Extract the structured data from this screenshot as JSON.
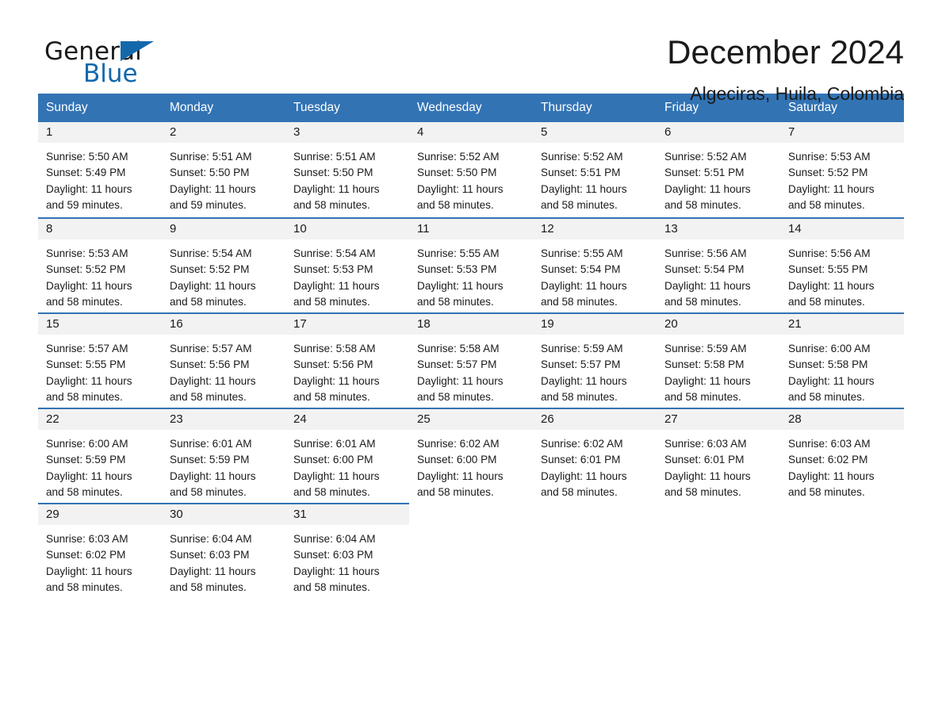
{
  "brand": {
    "word_one": "General",
    "word_two": "Blue",
    "triangle_icon": "triangle-logo-icon",
    "accent_color": "#1368ab"
  },
  "header": {
    "month_title": "December 2024",
    "location": "Algeciras, Huila, Colombia"
  },
  "theme": {
    "header_blue": "#3273b4",
    "daynum_bg": "#f2f2f2",
    "text": "#1a1a1a"
  },
  "calendar": {
    "weekday_headers": [
      "Sunday",
      "Monday",
      "Tuesday",
      "Wednesday",
      "Thursday",
      "Friday",
      "Saturday"
    ],
    "labels": {
      "sunrise_prefix": "Sunrise:",
      "sunset_prefix": "Sunset:",
      "daylight_prefix": "Daylight:"
    },
    "weeks": [
      [
        {
          "day": "1",
          "sunrise": "Sunrise: 5:50 AM",
          "sunset": "Sunset: 5:49 PM",
          "daylight_line1": "Daylight: 11 hours",
          "daylight_line2": "and 59 minutes."
        },
        {
          "day": "2",
          "sunrise": "Sunrise: 5:51 AM",
          "sunset": "Sunset: 5:50 PM",
          "daylight_line1": "Daylight: 11 hours",
          "daylight_line2": "and 59 minutes."
        },
        {
          "day": "3",
          "sunrise": "Sunrise: 5:51 AM",
          "sunset": "Sunset: 5:50 PM",
          "daylight_line1": "Daylight: 11 hours",
          "daylight_line2": "and 58 minutes."
        },
        {
          "day": "4",
          "sunrise": "Sunrise: 5:52 AM",
          "sunset": "Sunset: 5:50 PM",
          "daylight_line1": "Daylight: 11 hours",
          "daylight_line2": "and 58 minutes."
        },
        {
          "day": "5",
          "sunrise": "Sunrise: 5:52 AM",
          "sunset": "Sunset: 5:51 PM",
          "daylight_line1": "Daylight: 11 hours",
          "daylight_line2": "and 58 minutes."
        },
        {
          "day": "6",
          "sunrise": "Sunrise: 5:52 AM",
          "sunset": "Sunset: 5:51 PM",
          "daylight_line1": "Daylight: 11 hours",
          "daylight_line2": "and 58 minutes."
        },
        {
          "day": "7",
          "sunrise": "Sunrise: 5:53 AM",
          "sunset": "Sunset: 5:52 PM",
          "daylight_line1": "Daylight: 11 hours",
          "daylight_line2": "and 58 minutes."
        }
      ],
      [
        {
          "day": "8",
          "sunrise": "Sunrise: 5:53 AM",
          "sunset": "Sunset: 5:52 PM",
          "daylight_line1": "Daylight: 11 hours",
          "daylight_line2": "and 58 minutes."
        },
        {
          "day": "9",
          "sunrise": "Sunrise: 5:54 AM",
          "sunset": "Sunset: 5:52 PM",
          "daylight_line1": "Daylight: 11 hours",
          "daylight_line2": "and 58 minutes."
        },
        {
          "day": "10",
          "sunrise": "Sunrise: 5:54 AM",
          "sunset": "Sunset: 5:53 PM",
          "daylight_line1": "Daylight: 11 hours",
          "daylight_line2": "and 58 minutes."
        },
        {
          "day": "11",
          "sunrise": "Sunrise: 5:55 AM",
          "sunset": "Sunset: 5:53 PM",
          "daylight_line1": "Daylight: 11 hours",
          "daylight_line2": "and 58 minutes."
        },
        {
          "day": "12",
          "sunrise": "Sunrise: 5:55 AM",
          "sunset": "Sunset: 5:54 PM",
          "daylight_line1": "Daylight: 11 hours",
          "daylight_line2": "and 58 minutes."
        },
        {
          "day": "13",
          "sunrise": "Sunrise: 5:56 AM",
          "sunset": "Sunset: 5:54 PM",
          "daylight_line1": "Daylight: 11 hours",
          "daylight_line2": "and 58 minutes."
        },
        {
          "day": "14",
          "sunrise": "Sunrise: 5:56 AM",
          "sunset": "Sunset: 5:55 PM",
          "daylight_line1": "Daylight: 11 hours",
          "daylight_line2": "and 58 minutes."
        }
      ],
      [
        {
          "day": "15",
          "sunrise": "Sunrise: 5:57 AM",
          "sunset": "Sunset: 5:55 PM",
          "daylight_line1": "Daylight: 11 hours",
          "daylight_line2": "and 58 minutes."
        },
        {
          "day": "16",
          "sunrise": "Sunrise: 5:57 AM",
          "sunset": "Sunset: 5:56 PM",
          "daylight_line1": "Daylight: 11 hours",
          "daylight_line2": "and 58 minutes."
        },
        {
          "day": "17",
          "sunrise": "Sunrise: 5:58 AM",
          "sunset": "Sunset: 5:56 PM",
          "daylight_line1": "Daylight: 11 hours",
          "daylight_line2": "and 58 minutes."
        },
        {
          "day": "18",
          "sunrise": "Sunrise: 5:58 AM",
          "sunset": "Sunset: 5:57 PM",
          "daylight_line1": "Daylight: 11 hours",
          "daylight_line2": "and 58 minutes."
        },
        {
          "day": "19",
          "sunrise": "Sunrise: 5:59 AM",
          "sunset": "Sunset: 5:57 PM",
          "daylight_line1": "Daylight: 11 hours",
          "daylight_line2": "and 58 minutes."
        },
        {
          "day": "20",
          "sunrise": "Sunrise: 5:59 AM",
          "sunset": "Sunset: 5:58 PM",
          "daylight_line1": "Daylight: 11 hours",
          "daylight_line2": "and 58 minutes."
        },
        {
          "day": "21",
          "sunrise": "Sunrise: 6:00 AM",
          "sunset": "Sunset: 5:58 PM",
          "daylight_line1": "Daylight: 11 hours",
          "daylight_line2": "and 58 minutes."
        }
      ],
      [
        {
          "day": "22",
          "sunrise": "Sunrise: 6:00 AM",
          "sunset": "Sunset: 5:59 PM",
          "daylight_line1": "Daylight: 11 hours",
          "daylight_line2": "and 58 minutes."
        },
        {
          "day": "23",
          "sunrise": "Sunrise: 6:01 AM",
          "sunset": "Sunset: 5:59 PM",
          "daylight_line1": "Daylight: 11 hours",
          "daylight_line2": "and 58 minutes."
        },
        {
          "day": "24",
          "sunrise": "Sunrise: 6:01 AM",
          "sunset": "Sunset: 6:00 PM",
          "daylight_line1": "Daylight: 11 hours",
          "daylight_line2": "and 58 minutes."
        },
        {
          "day": "25",
          "sunrise": "Sunrise: 6:02 AM",
          "sunset": "Sunset: 6:00 PM",
          "daylight_line1": "Daylight: 11 hours",
          "daylight_line2": "and 58 minutes."
        },
        {
          "day": "26",
          "sunrise": "Sunrise: 6:02 AM",
          "sunset": "Sunset: 6:01 PM",
          "daylight_line1": "Daylight: 11 hours",
          "daylight_line2": "and 58 minutes."
        },
        {
          "day": "27",
          "sunrise": "Sunrise: 6:03 AM",
          "sunset": "Sunset: 6:01 PM",
          "daylight_line1": "Daylight: 11 hours",
          "daylight_line2": "and 58 minutes."
        },
        {
          "day": "28",
          "sunrise": "Sunrise: 6:03 AM",
          "sunset": "Sunset: 6:02 PM",
          "daylight_line1": "Daylight: 11 hours",
          "daylight_line2": "and 58 minutes."
        }
      ],
      [
        {
          "day": "29",
          "sunrise": "Sunrise: 6:03 AM",
          "sunset": "Sunset: 6:02 PM",
          "daylight_line1": "Daylight: 11 hours",
          "daylight_line2": "and 58 minutes."
        },
        {
          "day": "30",
          "sunrise": "Sunrise: 6:04 AM",
          "sunset": "Sunset: 6:03 PM",
          "daylight_line1": "Daylight: 11 hours",
          "daylight_line2": "and 58 minutes."
        },
        {
          "day": "31",
          "sunrise": "Sunrise: 6:04 AM",
          "sunset": "Sunset: 6:03 PM",
          "daylight_line1": "Daylight: 11 hours",
          "daylight_line2": "and 58 minutes."
        },
        {
          "day": "",
          "sunrise": "",
          "sunset": "",
          "daylight_line1": "",
          "daylight_line2": ""
        },
        {
          "day": "",
          "sunrise": "",
          "sunset": "",
          "daylight_line1": "",
          "daylight_line2": ""
        },
        {
          "day": "",
          "sunrise": "",
          "sunset": "",
          "daylight_line1": "",
          "daylight_line2": ""
        },
        {
          "day": "",
          "sunrise": "",
          "sunset": "",
          "daylight_line1": "",
          "daylight_line2": ""
        }
      ]
    ]
  }
}
